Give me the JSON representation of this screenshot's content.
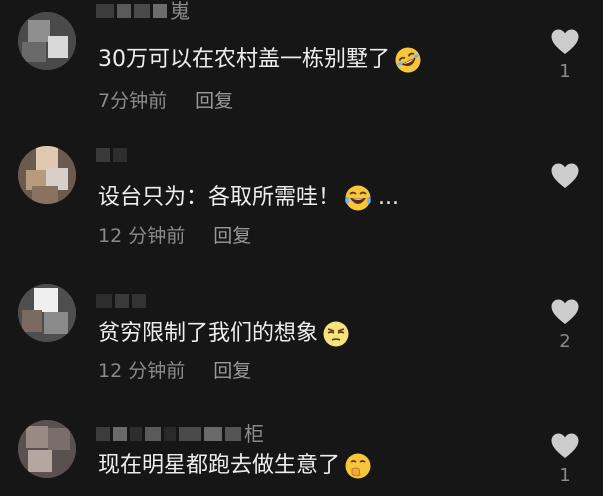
{
  "colors": {
    "background": "#161616",
    "text": "#eeeeee",
    "muted": "#8a8a8a",
    "heart": "#cccccc"
  },
  "comments": [
    {
      "username": "嵬",
      "text": "30万可以在农村盖一栋别墅了",
      "emoji": "rolling-laughing-emoji",
      "time": "7分钟前",
      "reply": "回复",
      "likes": "1"
    },
    {
      "username": "",
      "text": "设台只为：各取所需哇！",
      "emoji": "laughing-tears-emoji",
      "suffix": "...",
      "time": "12 分钟前",
      "reply": "回复",
      "likes": ""
    },
    {
      "username": "",
      "text": "贫穷限制了我们的想象",
      "emoji": "squinting-emoji",
      "time": "12 分钟前",
      "reply": "回复",
      "likes": "2"
    },
    {
      "username": "柜",
      "text": "现在明星都跑去做生意了",
      "emoji": "hand-over-mouth-emoji",
      "time": "",
      "reply": "",
      "likes": "1"
    }
  ]
}
